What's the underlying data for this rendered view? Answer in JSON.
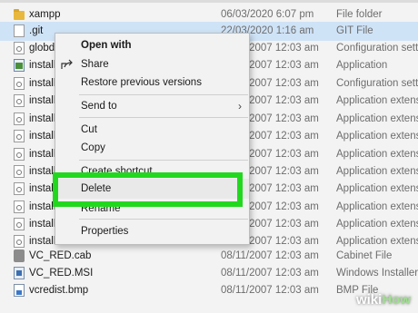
{
  "files": [
    {
      "name": "xampp",
      "date": "06/03/2020 6:07 pm",
      "type": "File folder",
      "icon": "folder-icon"
    },
    {
      "name": ".git",
      "date": "22/03/2020 1:16 am",
      "type": "GIT File",
      "icon": "file-icon",
      "selected": true
    },
    {
      "name": "globd",
      "date": "08/11/2007 12:03 am",
      "type": "Configuration setti...",
      "icon": "config-file-icon"
    },
    {
      "name": "install",
      "date": "08/11/2007 12:03 am",
      "type": "Application",
      "icon": "application-icon"
    },
    {
      "name": "install",
      "date": "08/11/2007 12:03 am",
      "type": "Configuration setti...",
      "icon": "config-file-icon"
    },
    {
      "name": "install",
      "date": "08/11/2007 12:03 am",
      "type": "Application extens...",
      "icon": "dll-icon"
    },
    {
      "name": "install",
      "date": "08/11/2007 12:03 am",
      "type": "Application extens...",
      "icon": "dll-icon"
    },
    {
      "name": "install",
      "date": "08/11/2007 12:03 am",
      "type": "Application extens...",
      "icon": "dll-icon"
    },
    {
      "name": "install",
      "date": "08/11/2007 12:03 am",
      "type": "Application extens...",
      "icon": "dll-icon"
    },
    {
      "name": "install",
      "date": "08/11/2007 12:03 am",
      "type": "Application extens...",
      "icon": "dll-icon"
    },
    {
      "name": "install",
      "date": "08/11/2007 12:03 am",
      "type": "Application extens...",
      "icon": "dll-icon"
    },
    {
      "name": "install",
      "date": "08/11/2007 12:03 am",
      "type": "Application extens...",
      "icon": "dll-icon"
    },
    {
      "name": "install",
      "date": "08/11/2007 12:03 am",
      "type": "Application extens...",
      "icon": "dll-icon"
    },
    {
      "name": "install",
      "date": "08/11/2007 12:03 am",
      "type": "Application extens...",
      "icon": "dll-icon"
    },
    {
      "name": "VC_RED.cab",
      "date": "08/11/2007 12:03 am",
      "type": "Cabinet File",
      "icon": "cabinet-icon"
    },
    {
      "name": "VC_RED.MSI",
      "date": "08/11/2007 12:03 am",
      "type": "Windows Installer ...",
      "icon": "installer-icon"
    },
    {
      "name": "vcredist.bmp",
      "date": "08/11/2007 12:03 am",
      "type": "BMP File",
      "icon": "bitmap-icon"
    }
  ],
  "context_menu": {
    "open_with": "Open with",
    "share": "Share",
    "restore": "Restore previous versions",
    "send_to": "Send to",
    "cut": "Cut",
    "copy": "Copy",
    "create_shortcut": "Create shortcut",
    "delete": "Delete",
    "rename": "Rename",
    "properties": "Properties"
  },
  "accent": {
    "highlight": "#22d81e",
    "selection": "#cfe3f7"
  },
  "watermark": {
    "a": "wiki",
    "b": "How"
  }
}
